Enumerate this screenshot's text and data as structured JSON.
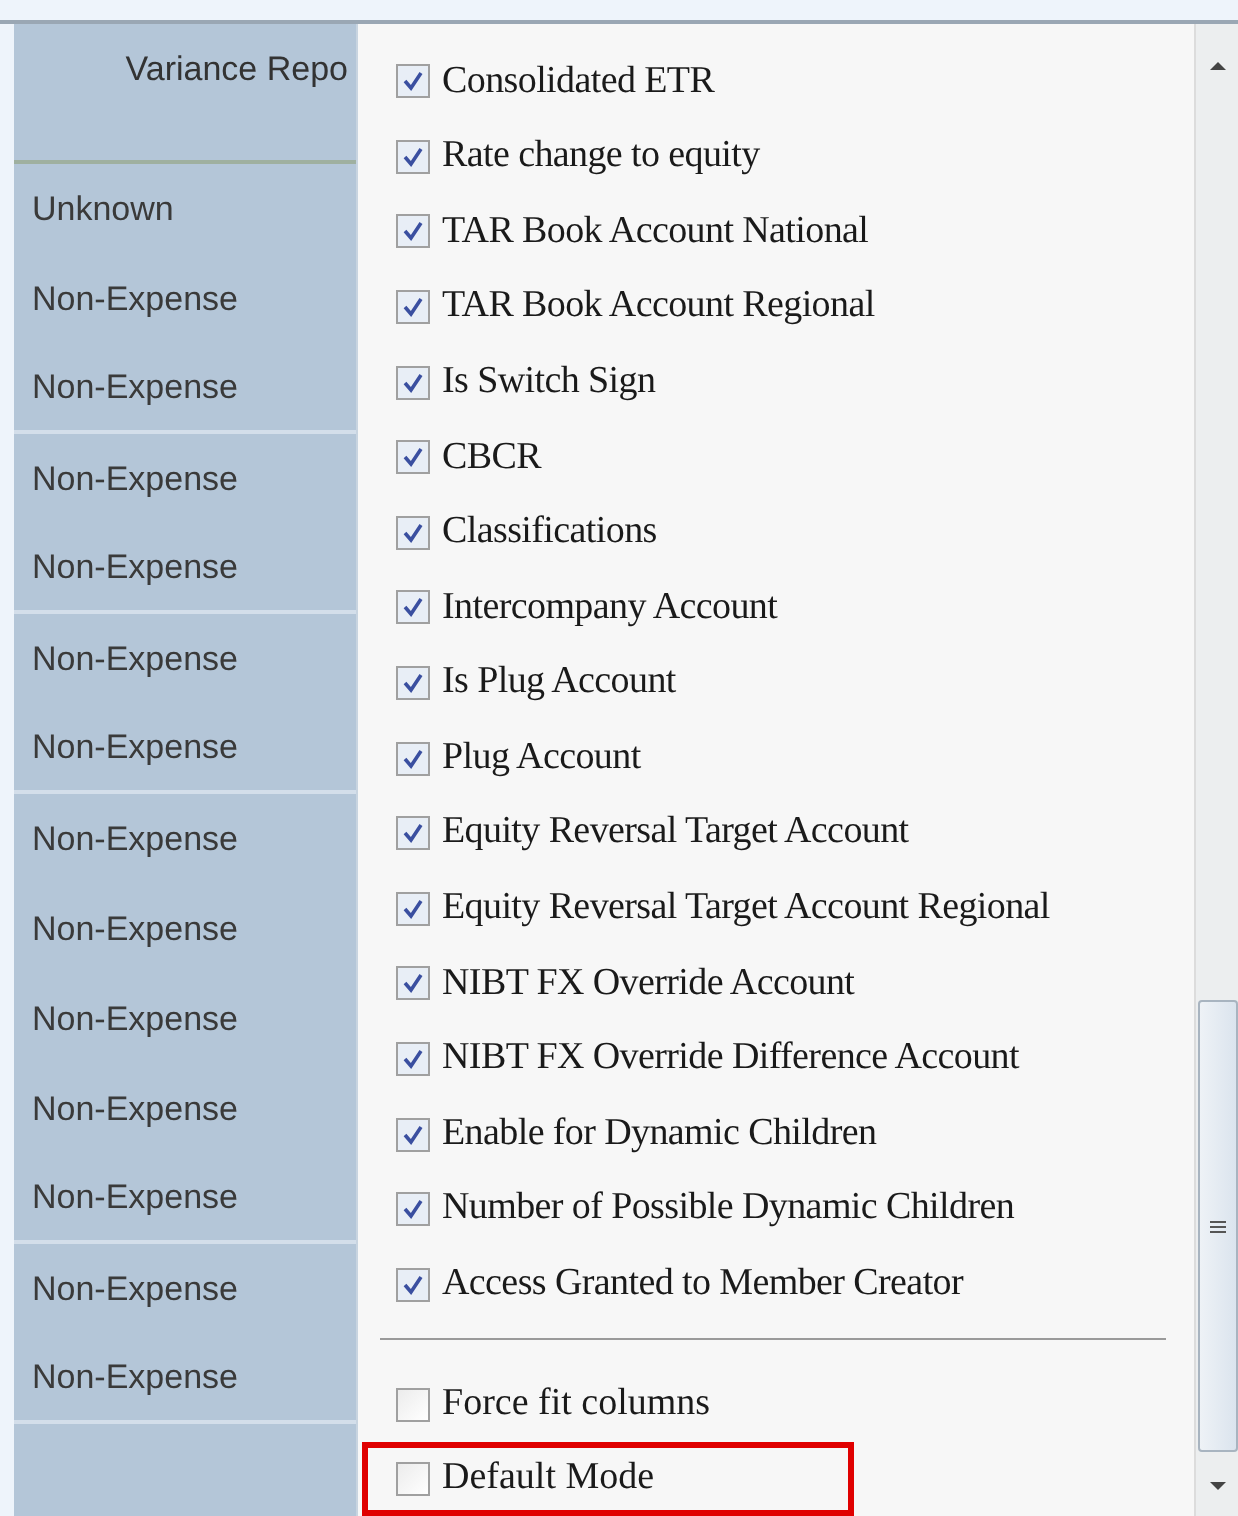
{
  "grid": {
    "header": "Variance Repo",
    "rows": [
      {
        "value": "Unknown",
        "divider": false
      },
      {
        "value": "Non-Expense",
        "divider": false
      },
      {
        "value": "Non-Expense",
        "divider": true
      },
      {
        "value": "Non-Expense",
        "divider": false
      },
      {
        "value": "Non-Expense",
        "divider": true
      },
      {
        "value": "Non-Expense",
        "divider": false
      },
      {
        "value": "Non-Expense",
        "divider": true
      },
      {
        "value": "Non-Expense",
        "divider": false
      },
      {
        "value": "Non-Expense",
        "divider": false
      },
      {
        "value": "Non-Expense",
        "divider": false
      },
      {
        "value": "Non-Expense",
        "divider": false
      },
      {
        "value": "Non-Expense",
        "divider": true
      },
      {
        "value": "Non-Expense",
        "divider": false
      },
      {
        "value": "Non-Expense",
        "divider": true
      }
    ]
  },
  "menu": {
    "columns": [
      {
        "label": "Consolidated ETR",
        "checked": true
      },
      {
        "label": "Rate change to equity",
        "checked": true
      },
      {
        "label": "TAR Book Account National",
        "checked": true
      },
      {
        "label": "TAR Book Account Regional",
        "checked": true
      },
      {
        "label": "Is Switch Sign",
        "checked": true
      },
      {
        "label": "CBCR",
        "checked": true
      },
      {
        "label": "Classifications",
        "checked": true
      },
      {
        "label": "Intercompany Account",
        "checked": true
      },
      {
        "label": "Is Plug Account",
        "checked": true
      },
      {
        "label": "Plug Account",
        "checked": true
      },
      {
        "label": "Equity Reversal Target Account",
        "checked": true
      },
      {
        "label": "Equity Reversal Target Account Regional",
        "checked": true
      },
      {
        "label": "NIBT FX Override Account",
        "checked": true
      },
      {
        "label": "NIBT FX Override Difference Account",
        "checked": true
      },
      {
        "label": "Enable for Dynamic Children",
        "checked": true
      },
      {
        "label": "Number of Possible Dynamic Children",
        "checked": true
      },
      {
        "label": "Access Granted to Member Creator",
        "checked": true
      }
    ],
    "options": [
      {
        "label": "Force fit columns",
        "checked": false,
        "highlighted": false
      },
      {
        "label": "Default Mode",
        "checked": false,
        "highlighted": true
      }
    ]
  }
}
